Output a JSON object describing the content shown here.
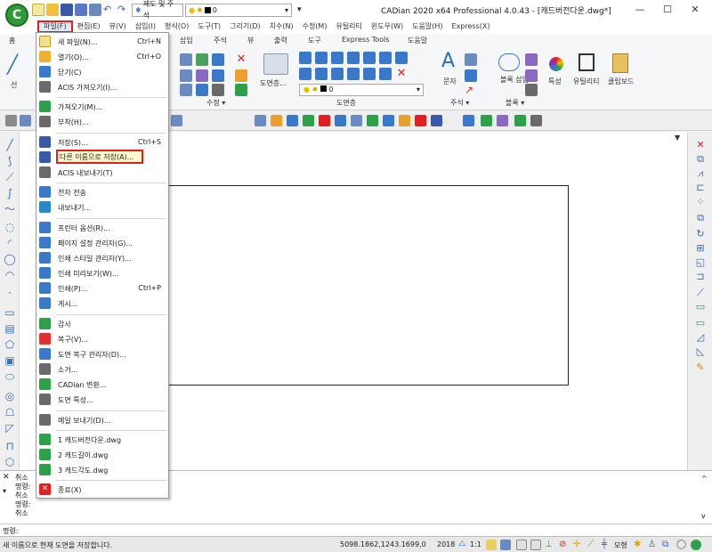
{
  "window": {
    "title": "CADian 2020 x64 Professional 4.0.43 - [캐드버전다운.dwg*]",
    "minimize": "—",
    "maximize": "☐",
    "close": "✕"
  },
  "qat": {
    "workspace": "제도 및 주석",
    "layer": "0"
  },
  "menubar": {
    "items": [
      "파일(F)",
      "편집(E)",
      "뷰(V)",
      "삽입(I)",
      "형식(O)",
      "도구(T)",
      "그리기(D)",
      "치수(N)",
      "수정(M)",
      "유틸리티",
      "윈도우(W)",
      "도움말(H)",
      "Express(X)"
    ]
  },
  "ribbon": {
    "tabs": [
      "홈",
      "삽입",
      "주석",
      "뷰",
      "출력",
      "도구",
      "Express Tools",
      "도움말"
    ],
    "groups": {
      "modify": "수정 ▾",
      "layer": "도면층",
      "annotation": "주석 ▾",
      "block": "블록 ▾"
    },
    "buttons": {
      "line": "선",
      "layer_props": "도면층...",
      "text": "문자",
      "block_insert": "블록 삽입...",
      "properties": "특성",
      "utility": "유틸리티",
      "clipboard": "클립보드",
      "layer_value": "0"
    }
  },
  "filemenu": {
    "items": [
      {
        "label": "새 파일(N)...",
        "shortcut": "Ctrl+N",
        "icon": "new-file-icon",
        "color": "#f0c040"
      },
      {
        "label": "열기(O)...",
        "shortcut": "Ctrl+O",
        "icon": "open-icon",
        "color": "#f0b030"
      },
      {
        "label": "닫기(C)",
        "shortcut": "",
        "icon": "close-file-icon",
        "color": "#3a78c9"
      },
      {
        "label": "ACIS 가져오기(I)...",
        "shortcut": "",
        "icon": "acis-import-icon",
        "color": "#6a6a6a"
      },
      {
        "label": "가져오기(M)...",
        "shortcut": "",
        "icon": "import-icon",
        "color": "#2ea04a"
      },
      {
        "label": "부착(H)...",
        "shortcut": "",
        "icon": "attach-icon",
        "color": "#6a6a6a"
      },
      {
        "label": "저장(S)...",
        "shortcut": "Ctrl+S",
        "icon": "save-icon",
        "color": "#3a58a9"
      },
      {
        "label": "다른 이름으로 저장(A)...",
        "shortcut": "",
        "icon": "save-as-icon",
        "color": "#3a58a9"
      },
      {
        "label": "ACIS 내보내기(T)",
        "shortcut": "",
        "icon": "acis-export-icon",
        "color": "#6a6a6a"
      },
      {
        "label": "전자 전송",
        "shortcut": "",
        "icon": "etransmit-icon",
        "color": "#3a78c9"
      },
      {
        "label": "내보내기...",
        "shortcut": "",
        "icon": "export-icon",
        "color": "#2a88c9"
      },
      {
        "label": "프린터 옵션(R)...",
        "shortcut": "",
        "icon": "printer-options-icon",
        "color": "#3a78c9"
      },
      {
        "label": "페이지 설정 관리자(G)...",
        "shortcut": "",
        "icon": "page-setup-icon",
        "color": "#3a78c9"
      },
      {
        "label": "인쇄 스타일 관리자(Y)...",
        "shortcut": "",
        "icon": "plot-style-icon",
        "color": "#3a78c9"
      },
      {
        "label": "인쇄 미리보기(W)...",
        "shortcut": "",
        "icon": "print-preview-icon",
        "color": "#3a78c9"
      },
      {
        "label": "인쇄(P)...",
        "shortcut": "Ctrl+P",
        "icon": "print-icon",
        "color": "#3a78c9"
      },
      {
        "label": "게시...",
        "shortcut": "",
        "icon": "publish-icon",
        "color": "#3a78c9"
      },
      {
        "label": "감사",
        "shortcut": "",
        "icon": "audit-icon",
        "color": "#2ea04a"
      },
      {
        "label": "복구(V)...",
        "shortcut": "",
        "icon": "recover-icon",
        "color": "#e03030"
      },
      {
        "label": "도면 복구 관리자(D)...",
        "shortcut": "",
        "icon": "recovery-manager-icon",
        "color": "#3a78c9"
      },
      {
        "label": "소거...",
        "shortcut": "",
        "icon": "purge-icon",
        "color": "#6a6a6a"
      },
      {
        "label": "CADian 변환...",
        "shortcut": "",
        "icon": "convert-icon",
        "color": "#2ea04a"
      },
      {
        "label": "도면 특성...",
        "shortcut": "",
        "icon": "drawing-properties-icon",
        "color": "#6a6a6a"
      },
      {
        "label": "메일 보내기(D)...",
        "shortcut": "",
        "icon": "mail-icon",
        "color": "#6a6a6a"
      },
      {
        "label": "1 캐드버전다운.dwg",
        "shortcut": "",
        "icon": "recent-file-icon",
        "color": "#2ea04a"
      },
      {
        "label": "2 캐드길이.dwg",
        "shortcut": "",
        "icon": "recent-file-icon",
        "color": "#2ea04a"
      },
      {
        "label": "3 캐드각도.dwg",
        "shortcut": "",
        "icon": "recent-file-icon",
        "color": "#2ea04a"
      },
      {
        "label": "종료(X)",
        "shortcut": "",
        "icon": "exit-icon",
        "color": "#e02020"
      }
    ]
  },
  "command": {
    "lines": [
      "취소",
      "명령:",
      "취소",
      "명령:",
      "취소"
    ],
    "prompt": "명령:"
  },
  "status": {
    "message": "새 이름으로 현재 도면을 저장합니다.",
    "coords": "5098.1862,1243.1699,0",
    "version": "2018",
    "scale": "1:1",
    "model": "모형"
  },
  "colors": {
    "highlight_border": "#e02020",
    "accent_green": "#2e9b39"
  }
}
